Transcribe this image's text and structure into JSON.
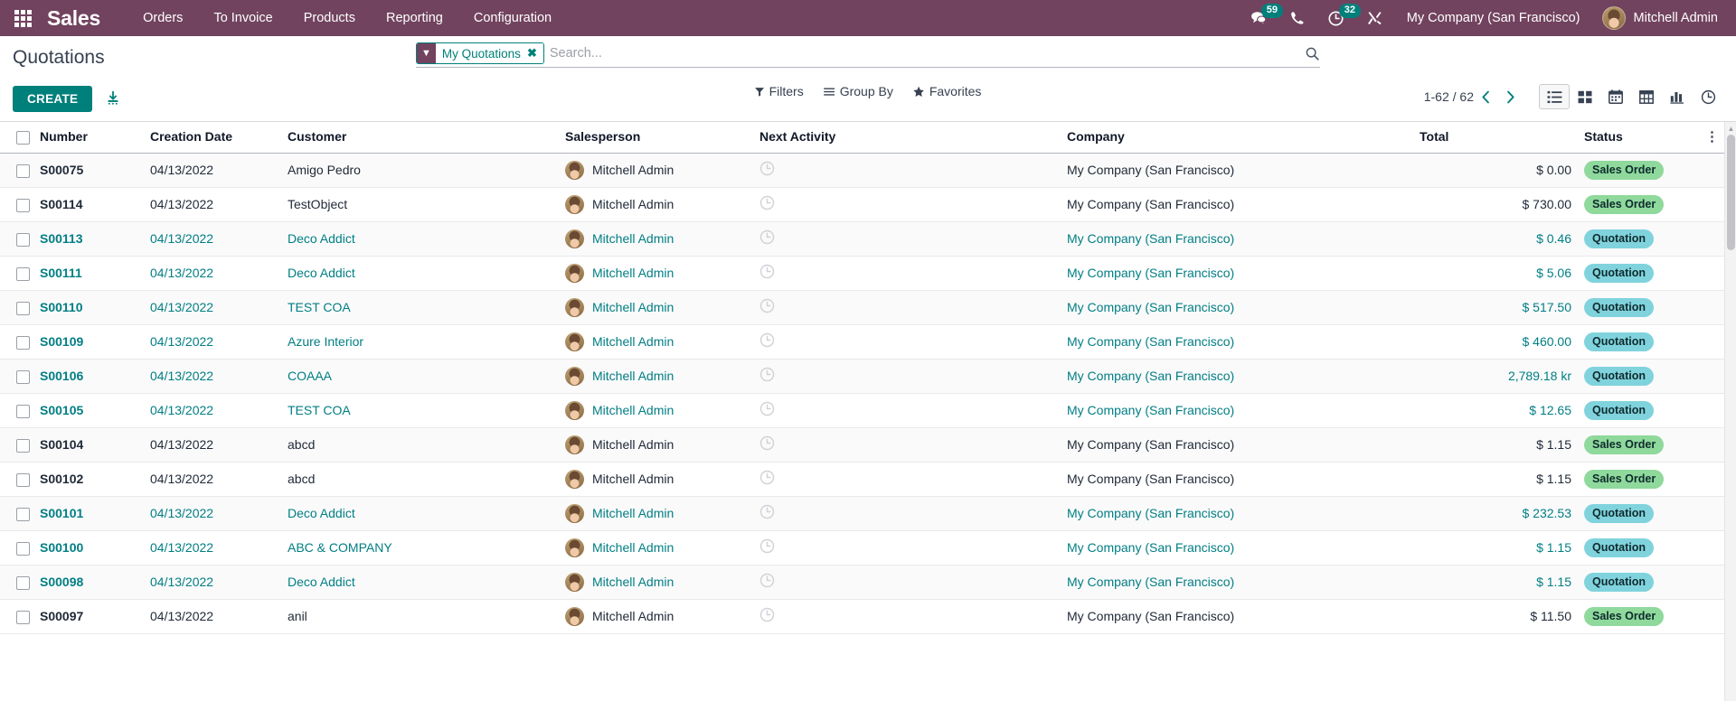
{
  "navbar": {
    "apps_icon": "apps-grid-icon",
    "brand": "Sales",
    "menu": [
      {
        "label": "Orders"
      },
      {
        "label": "To Invoice"
      },
      {
        "label": "Products"
      },
      {
        "label": "Reporting"
      },
      {
        "label": "Configuration"
      }
    ],
    "systray": {
      "messages_icon": "messages-icon",
      "messages_count": "59",
      "voip_icon": "phone-icon",
      "activities_icon": "clock-icon",
      "activities_count": "32",
      "debug_icon": "tools-icon"
    },
    "company": "My Company (San Francisco)",
    "user_name": "Mitchell Admin",
    "avatar_icon": "user-avatar",
    "accent_color": "#71435f",
    "badge_color": "#00807b"
  },
  "control_panel": {
    "title": "Quotations",
    "create_label": "CREATE",
    "import_icon": "import-download-icon",
    "search": {
      "facet_icon": "filter-funnel-icon",
      "facet_label": "My Quotations",
      "facet_close_icon": "close-x-icon",
      "placeholder": "Search...",
      "value": "",
      "magnifier_icon": "search-icon"
    },
    "filters": [
      {
        "icon": "filter-funnel-icon",
        "label": "Filters"
      },
      {
        "icon": "group-by-lines-icon",
        "label": "Group By"
      },
      {
        "icon": "star-icon",
        "label": "Favorites"
      }
    ],
    "pager": {
      "range": "1-62 / 62",
      "prev_icon": "chevron-left-icon",
      "next_icon": "chevron-right-icon"
    },
    "views": [
      {
        "name": "list-view",
        "icon": "list-icon",
        "active": true
      },
      {
        "name": "kanban-view",
        "icon": "kanban-icon",
        "active": false
      },
      {
        "name": "calendar-view",
        "icon": "calendar-icon",
        "active": false
      },
      {
        "name": "pivot-view",
        "icon": "pivot-table-icon",
        "active": false
      },
      {
        "name": "graph-view",
        "icon": "bar-chart-icon",
        "active": false
      },
      {
        "name": "activity-view",
        "icon": "clock-icon",
        "active": false
      }
    ]
  },
  "list": {
    "columns": [
      {
        "key": "number",
        "label": "Number"
      },
      {
        "key": "creation_date",
        "label": "Creation Date"
      },
      {
        "key": "customer",
        "label": "Customer"
      },
      {
        "key": "salesperson",
        "label": "Salesperson"
      },
      {
        "key": "next_activity",
        "label": "Next Activity"
      },
      {
        "key": "company",
        "label": "Company"
      },
      {
        "key": "total",
        "label": "Total"
      },
      {
        "key": "status",
        "label": "Status"
      }
    ],
    "select_all_icon": "checkbox-unchecked-icon",
    "optional_columns_icon": "vertical-dots-icon",
    "activity_icon": "clock-icon",
    "rows": [
      {
        "number": "S00075",
        "creation_date": "04/13/2022",
        "customer": "Amigo Pedro",
        "salesperson": "Mitchell Admin",
        "company": "My Company (San Francisco)",
        "total": "$ 0.00",
        "status": "Sales Order",
        "status_kind": "sales-order",
        "link": false
      },
      {
        "number": "S00114",
        "creation_date": "04/13/2022",
        "customer": "TestObject",
        "salesperson": "Mitchell Admin",
        "company": "My Company (San Francisco)",
        "total": "$ 730.00",
        "status": "Sales Order",
        "status_kind": "sales-order",
        "link": false
      },
      {
        "number": "S00113",
        "creation_date": "04/13/2022",
        "customer": "Deco Addict",
        "salesperson": "Mitchell Admin",
        "company": "My Company (San Francisco)",
        "total": "$ 0.46",
        "status": "Quotation",
        "status_kind": "quotation",
        "link": true
      },
      {
        "number": "S00111",
        "creation_date": "04/13/2022",
        "customer": "Deco Addict",
        "salesperson": "Mitchell Admin",
        "company": "My Company (San Francisco)",
        "total": "$ 5.06",
        "status": "Quotation",
        "status_kind": "quotation",
        "link": true
      },
      {
        "number": "S00110",
        "creation_date": "04/13/2022",
        "customer": "TEST COA",
        "salesperson": "Mitchell Admin",
        "company": "My Company (San Francisco)",
        "total": "$ 517.50",
        "status": "Quotation",
        "status_kind": "quotation",
        "link": true
      },
      {
        "number": "S00109",
        "creation_date": "04/13/2022",
        "customer": "Azure Interior",
        "salesperson": "Mitchell Admin",
        "company": "My Company (San Francisco)",
        "total": "$ 460.00",
        "status": "Quotation",
        "status_kind": "quotation",
        "link": true
      },
      {
        "number": "S00106",
        "creation_date": "04/13/2022",
        "customer": "COAAA",
        "salesperson": "Mitchell Admin",
        "company": "My Company (San Francisco)",
        "total": "2,789.18 kr",
        "status": "Quotation",
        "status_kind": "quotation",
        "link": true
      },
      {
        "number": "S00105",
        "creation_date": "04/13/2022",
        "customer": "TEST COA",
        "salesperson": "Mitchell Admin",
        "company": "My Company (San Francisco)",
        "total": "$ 12.65",
        "status": "Quotation",
        "status_kind": "quotation",
        "link": true
      },
      {
        "number": "S00104",
        "creation_date": "04/13/2022",
        "customer": "abcd",
        "salesperson": "Mitchell Admin",
        "company": "My Company (San Francisco)",
        "total": "$ 1.15",
        "status": "Sales Order",
        "status_kind": "sales-order",
        "link": false
      },
      {
        "number": "S00102",
        "creation_date": "04/13/2022",
        "customer": "abcd",
        "salesperson": "Mitchell Admin",
        "company": "My Company (San Francisco)",
        "total": "$ 1.15",
        "status": "Sales Order",
        "status_kind": "sales-order",
        "link": false
      },
      {
        "number": "S00101",
        "creation_date": "04/13/2022",
        "customer": "Deco Addict",
        "salesperson": "Mitchell Admin",
        "company": "My Company (San Francisco)",
        "total": "$ 232.53",
        "status": "Quotation",
        "status_kind": "quotation",
        "link": true
      },
      {
        "number": "S00100",
        "creation_date": "04/13/2022",
        "customer": "ABC & COMPANY",
        "salesperson": "Mitchell Admin",
        "company": "My Company (San Francisco)",
        "total": "$ 1.15",
        "status": "Quotation",
        "status_kind": "quotation",
        "link": true
      },
      {
        "number": "S00098",
        "creation_date": "04/13/2022",
        "customer": "Deco Addict",
        "salesperson": "Mitchell Admin",
        "company": "My Company (San Francisco)",
        "total": "$ 1.15",
        "status": "Quotation",
        "status_kind": "quotation",
        "link": true
      },
      {
        "number": "S00097",
        "creation_date": "04/13/2022",
        "customer": "anil",
        "salesperson": "Mitchell Admin",
        "company": "My Company (San Francisco)",
        "total": "$ 11.50",
        "status": "Sales Order",
        "status_kind": "sales-order",
        "link": false
      }
    ]
  },
  "colors": {
    "brand_purple": "#71435f",
    "teal": "#00807b",
    "link_blue": "#017e84",
    "badge_quotation": "#80d3dd",
    "badge_sales_order": "#8ed99b"
  }
}
